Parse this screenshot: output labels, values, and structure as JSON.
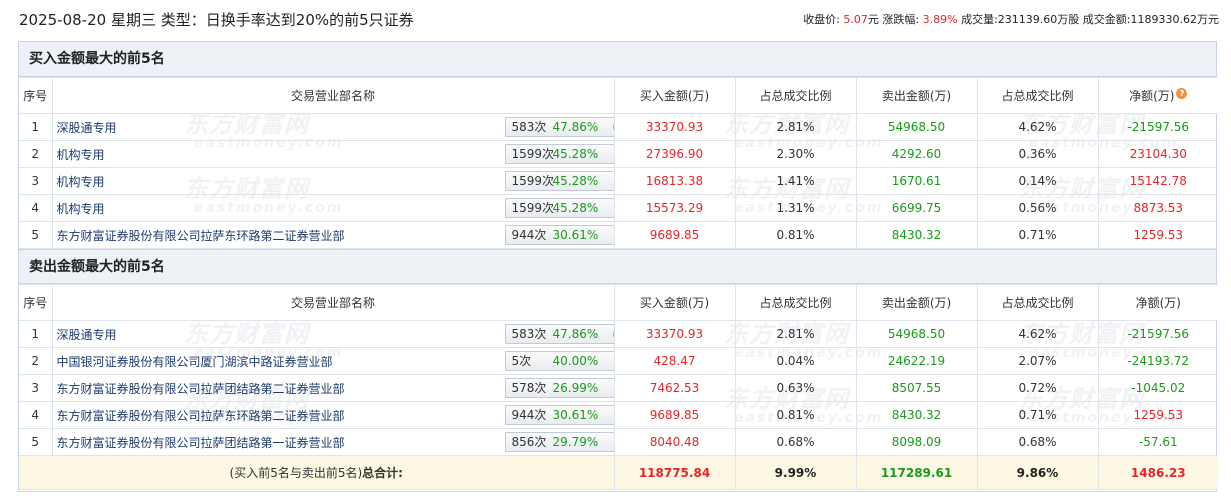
{
  "header": {
    "date": "2025-08-20",
    "weekday": "星期三",
    "type_label": "类型：",
    "type_value": "日换手率达到20%的前5只证券",
    "close_label": "收盘价:",
    "close_value": "5.07",
    "close_unit": "元",
    "change_label": "涨跌幅:",
    "change_value": "3.89%",
    "volume_label": "成交量:",
    "volume_value": "231139.60万股",
    "amount_label": "成交金额:",
    "amount_value": "1189330.62万元"
  },
  "columns": {
    "seq": "序号",
    "name": "交易营业部名称",
    "buy": "买入金额(万)",
    "buy_pct": "占总成交比例",
    "sell": "卖出金额(万)",
    "sell_pct": "占总成交比例",
    "net": "净额(万)",
    "help_icon": "?"
  },
  "buy_section": {
    "title": "买入金额最大的前5名",
    "rows": [
      {
        "seq": "1",
        "name": "深股通专用",
        "count": "583次",
        "rate": "47.86%",
        "buy": "33370.93",
        "buy_pct": "2.81%",
        "sell": "54968.50",
        "sell_pct": "4.62%",
        "net": "-21597.56",
        "icon": "help-icon"
      },
      {
        "seq": "2",
        "name": "机构专用",
        "count": "1599次",
        "rate": "45.28%",
        "buy": "27396.90",
        "buy_pct": "2.30%",
        "sell": "4292.60",
        "sell_pct": "0.36%",
        "net": "23104.30",
        "icon": "arrow-right-icon"
      },
      {
        "seq": "3",
        "name": "机构专用",
        "count": "1599次",
        "rate": "45.28%",
        "buy": "16813.38",
        "buy_pct": "1.41%",
        "sell": "1670.61",
        "sell_pct": "0.14%",
        "net": "15142.78",
        "icon": "arrow-right-icon"
      },
      {
        "seq": "4",
        "name": "机构专用",
        "count": "1599次",
        "rate": "45.28%",
        "buy": "15573.29",
        "buy_pct": "1.31%",
        "sell": "6699.75",
        "sell_pct": "0.56%",
        "net": "8873.53",
        "icon": "arrow-right-icon"
      },
      {
        "seq": "5",
        "name": "东方财富证券股份有限公司拉萨东环路第二证券营业部",
        "count": "944次",
        "rate": "30.61%",
        "buy": "9689.85",
        "buy_pct": "0.81%",
        "sell": "8430.32",
        "sell_pct": "0.71%",
        "net": "1259.53",
        "icon": "arrow-right-icon"
      }
    ]
  },
  "sell_section": {
    "title": "卖出金额最大的前5名",
    "rows": [
      {
        "seq": "1",
        "name": "深股通专用",
        "count": "583次",
        "rate": "47.86%",
        "buy": "33370.93",
        "buy_pct": "2.81%",
        "sell": "54968.50",
        "sell_pct": "4.62%",
        "net": "-21597.56",
        "icon": "help-icon"
      },
      {
        "seq": "2",
        "name": "中国银河证券股份有限公司厦门湖滨中路证券营业部",
        "count": "5次",
        "rate": "40.00%",
        "buy": "428.47",
        "buy_pct": "0.04%",
        "sell": "24622.19",
        "sell_pct": "2.07%",
        "net": "-24193.72",
        "icon": "arrow-right-icon"
      },
      {
        "seq": "3",
        "name": "东方财富证券股份有限公司拉萨团结路第二证券营业部",
        "count": "578次",
        "rate": "26.99%",
        "buy": "7462.53",
        "buy_pct": "0.63%",
        "sell": "8507.55",
        "sell_pct": "0.72%",
        "net": "-1045.02",
        "icon": "arrow-right-icon"
      },
      {
        "seq": "4",
        "name": "东方财富证券股份有限公司拉萨东环路第二证券营业部",
        "count": "944次",
        "rate": "30.61%",
        "buy": "9689.85",
        "buy_pct": "0.81%",
        "sell": "8430.32",
        "sell_pct": "0.71%",
        "net": "1259.53",
        "icon": "arrow-right-icon"
      },
      {
        "seq": "5",
        "name": "东方财富证券股份有限公司拉萨团结路第一证券营业部",
        "count": "856次",
        "rate": "29.79%",
        "buy": "8040.48",
        "buy_pct": "0.68%",
        "sell": "8098.09",
        "sell_pct": "0.68%",
        "net": "-57.61",
        "icon": "arrow-right-icon"
      }
    ]
  },
  "total": {
    "label_prefix": "(买入前5名与卖出前5名)",
    "label_bold": "总合计:",
    "buy": "118775.84",
    "buy_pct": "9.99%",
    "sell": "117289.61",
    "sell_pct": "9.86%",
    "net": "1486.23"
  },
  "watermark": {
    "cn": "东方财富网",
    "en": "eastmoney.com"
  },
  "colors": {
    "positive": "#e4262a",
    "negative": "#1a9a1a",
    "header_bg": "#eef2f7",
    "total_bg": "#fcf8e3"
  }
}
